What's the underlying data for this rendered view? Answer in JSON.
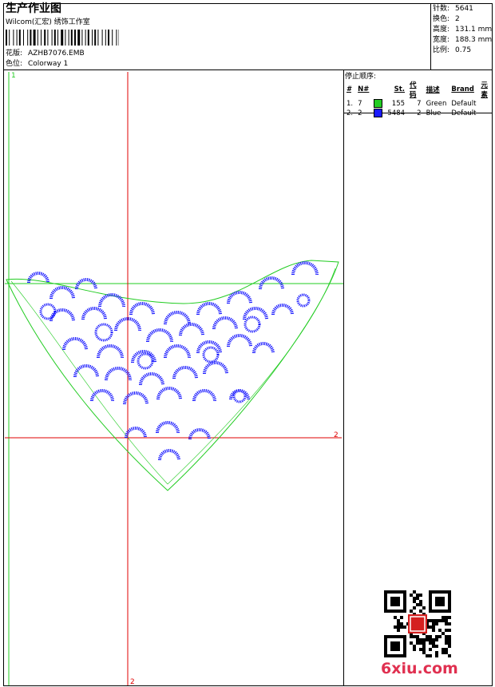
{
  "header": {
    "title": "生产作业图",
    "company": "Wilcom(汇宏) 绣饰工作室",
    "design_label": "花版:",
    "design_value": "AZHB7076.EMB",
    "colorway_label": "色位:",
    "colorway_value": "Colorway 1"
  },
  "stats": [
    {
      "label": "针数:",
      "value": "5641"
    },
    {
      "label": "换色:",
      "value": "2"
    },
    {
      "label": "高度:",
      "value": "131.1 mm"
    },
    {
      "label": "宽度:",
      "value": "188.3 mm"
    },
    {
      "label": "比例:",
      "value": "0.75"
    }
  ],
  "stop_sequence": {
    "title": "停止顺序:",
    "columns": [
      "#",
      "N#",
      "St.",
      "代码",
      "描述",
      "Brand",
      "元素"
    ],
    "rows": [
      {
        "index": "1.",
        "needle": "7",
        "stitches": "155",
        "code": "7",
        "description": "Green",
        "brand": "Default",
        "color": "#22cc22"
      },
      {
        "index": "2.",
        "needle": "2",
        "stitches": "5484",
        "code": "2",
        "description": "Blue",
        "brand": "Default",
        "color": "#1a1aff"
      }
    ]
  },
  "guides": {
    "mark_1": "1",
    "mark_2_right": "2",
    "mark_2_bottom": "2"
  },
  "watermark": "6xiu.com",
  "colors": {
    "thread_green": "#22cc22",
    "thread_blue": "#1a1aff",
    "guide_red": "#e00000"
  }
}
